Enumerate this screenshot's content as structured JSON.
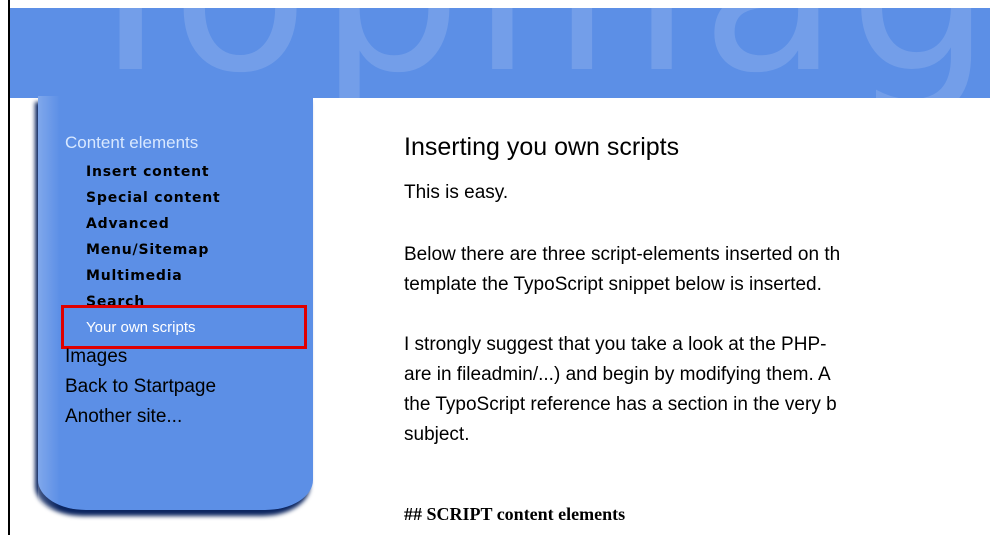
{
  "banner": {
    "background_text": "Topmag"
  },
  "nav": {
    "section_heading": "Content elements",
    "items": [
      {
        "label": "Insert content",
        "active": false
      },
      {
        "label": "Special content",
        "active": false
      },
      {
        "label": "Advanced",
        "active": false
      },
      {
        "label": "Menu/Sitemap",
        "active": false
      },
      {
        "label": "Multimedia",
        "active": false
      },
      {
        "label": "Search",
        "active": false
      },
      {
        "label": "Your own scripts",
        "active": true
      }
    ],
    "top_links": [
      {
        "label": "Images"
      },
      {
        "label": "Back to Startpage"
      },
      {
        "label": "Another site..."
      }
    ]
  },
  "content": {
    "title": "Inserting you own scripts",
    "paragraph1": "This is easy.",
    "paragraph2": [
      "Below there are three script-elements inserted on th",
      "template the TypoScript snippet below is inserted."
    ],
    "paragraph3": [
      "I strongly suggest that you take a look at the PHP-",
      "are in fileadmin/...) and begin by modifying them. A",
      "the TypoScript reference has a section in the very b",
      "subject."
    ],
    "code_line": "## SCRIPT content elements"
  },
  "colors": {
    "banner": "#5c8fe6",
    "nav_panel": "#5c8fe6",
    "nav_heading": "#d8e8ff",
    "highlight": "#e00000",
    "text": "#000000"
  }
}
